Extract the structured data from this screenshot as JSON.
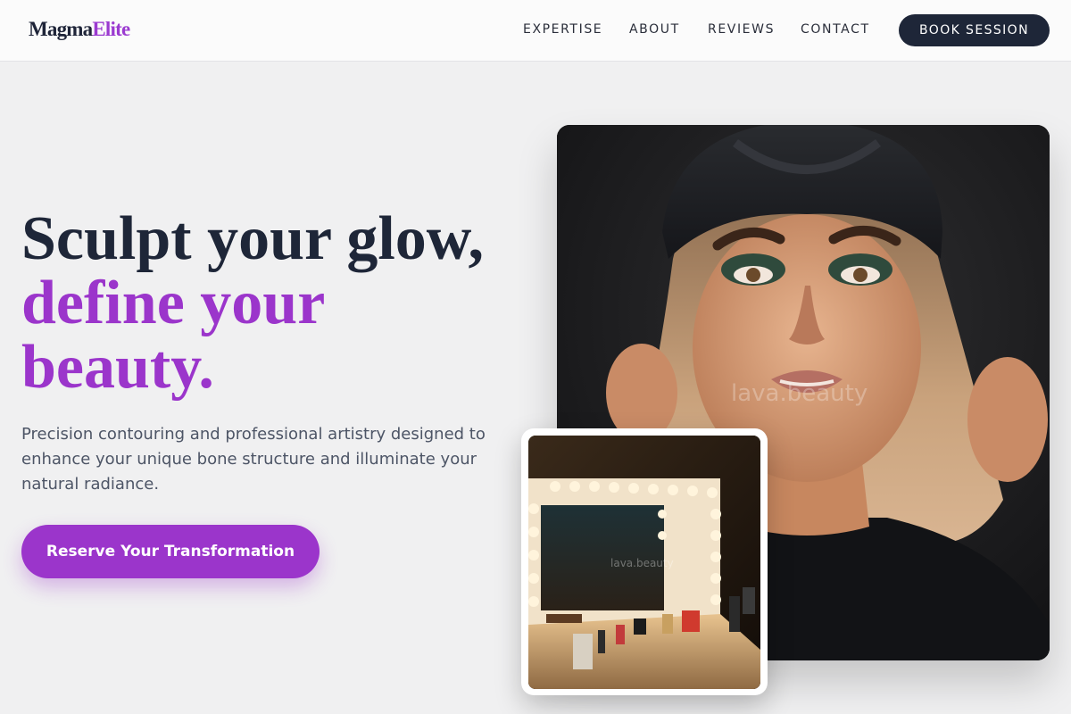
{
  "brand": {
    "name_part1": "Magma",
    "name_part2": "Elite"
  },
  "nav": {
    "items": [
      "EXPERTISE",
      "ABOUT",
      "REVIEWS",
      "CONTACT"
    ],
    "cta_label": "BOOK SESSION"
  },
  "hero": {
    "headline_line1": "Sculpt your glow,",
    "headline_line2": "define your",
    "headline_line3": "beauty.",
    "subtitle": "Precision contouring and professional artistry designed to enhance your unique bone structure and illuminate your natural radiance.",
    "cta_label": "Reserve Your Transformation"
  },
  "images": {
    "portrait_watermark": "lava.beauty",
    "vanity_watermark": "lava.beauty"
  },
  "colors": {
    "accent": "#9b35cb",
    "navy": "#1e2638",
    "background": "#f0f0f1"
  }
}
